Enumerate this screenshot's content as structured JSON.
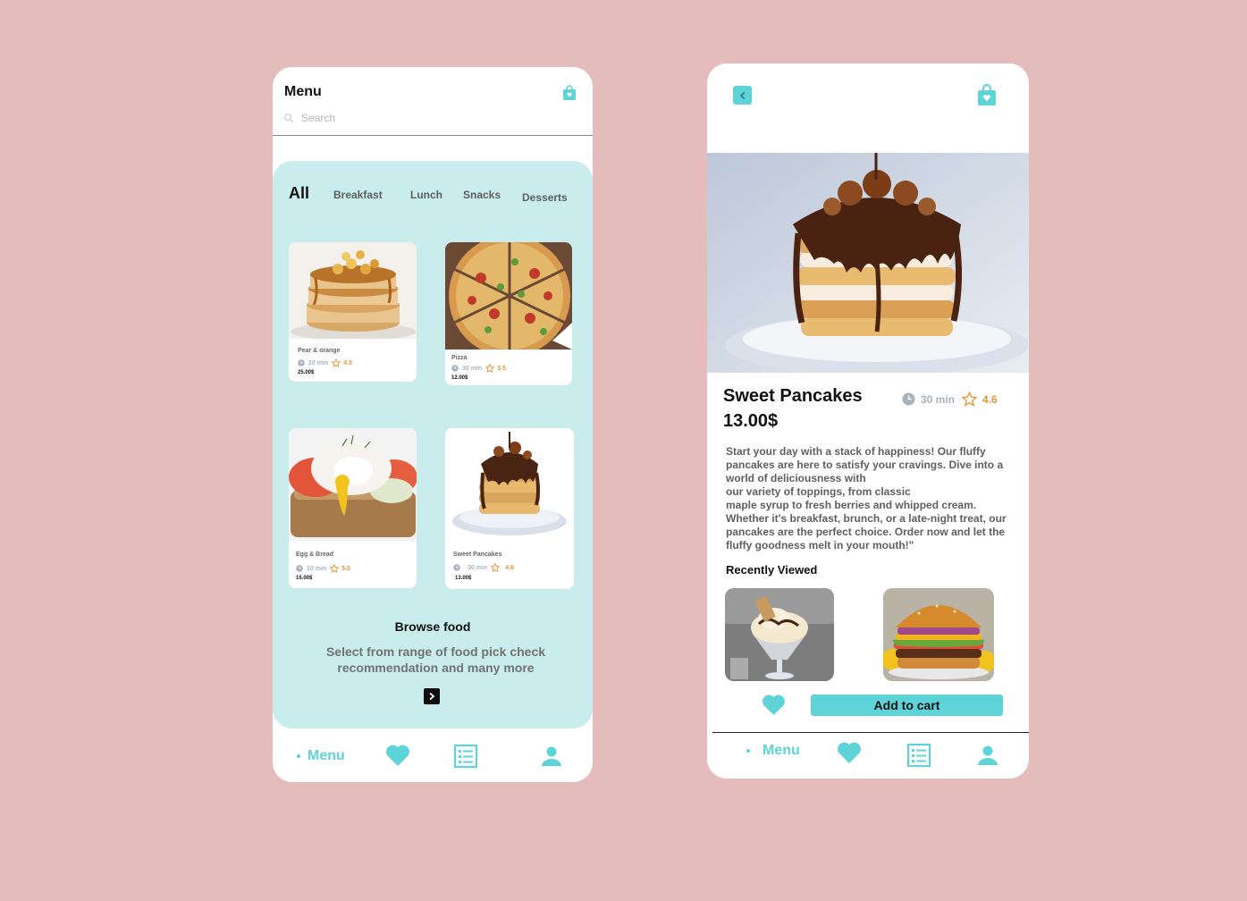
{
  "menu_screen": {
    "title": "Menu",
    "search_placeholder": "Search",
    "tabs": [
      {
        "label": "All",
        "active": true
      },
      {
        "label": "Breakfast",
        "active": false
      },
      {
        "label": "Lunch",
        "active": false
      },
      {
        "label": "Snacks",
        "active": false
      },
      {
        "label": "Desserts",
        "active": false
      }
    ],
    "items": [
      {
        "name": "Pear & orange",
        "time": "20 min",
        "rating": "4.5",
        "price": "25.00$"
      },
      {
        "name": "Pizza",
        "time": "30 min",
        "rating": "3.5",
        "price": "12.00$"
      },
      {
        "name": "Egg & Bread",
        "time": "10 min",
        "rating": "5.0",
        "price": "15.00$"
      },
      {
        "name": "Sweet Pancakes",
        "time": "30 min",
        "rating": "4.6",
        "price": "13.00$"
      }
    ],
    "browse_title": "Browse food",
    "browse_desc_line1": "Select from range of food pick check",
    "browse_desc_line2": "recommendation and many more",
    "nav": {
      "menu_label": "Menu"
    }
  },
  "detail_screen": {
    "title": "Sweet Pancakes",
    "price": "13.00$",
    "time": "30 min",
    "rating": "4.6",
    "description_lines": [
      "Start your day with a stack of happiness! Our fluffy",
      "pancakes are here to satisfy your cravings. Dive into a",
      "world of deliciousness with",
      "our variety of toppings, from classic",
      "maple syrup to fresh berries and whipped cream.",
      "Whether it's breakfast, brunch, or a late-night treat, our",
      "pancakes are the perfect choice. Order now and let the",
      "fluffy goodness melt in your mouth!\""
    ],
    "recently_viewed_title": "Recently Viewed",
    "add_to_cart_label": "Add to cart",
    "nav": {
      "menu_label": "Menu"
    }
  },
  "icons": [
    "shopping-bag-icon",
    "search-icon",
    "clock-icon",
    "star-icon",
    "chevron-right-icon",
    "chevron-left-icon",
    "heart-icon",
    "list-icon",
    "user-icon"
  ],
  "colors": {
    "background": "#e4bcbb",
    "accent": "#5ed3d8",
    "panel": "#c9eced",
    "rating": "#e4953a",
    "time": "#a9b3bd"
  }
}
